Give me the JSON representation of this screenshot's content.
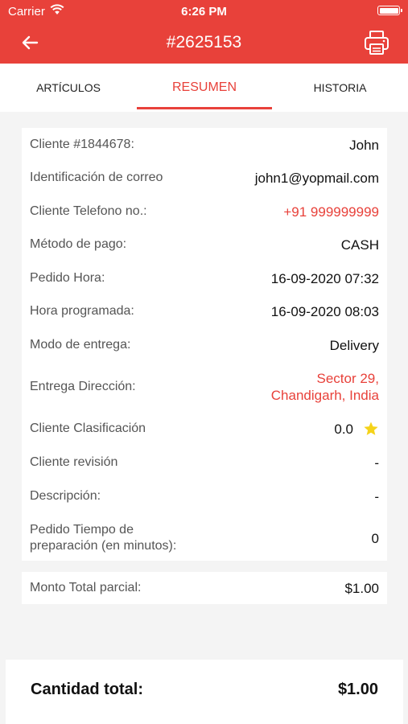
{
  "status_bar": {
    "carrier": "Carrier",
    "time": "6:26 PM"
  },
  "header": {
    "title": "#2625153",
    "back_icon": "arrow-left-icon",
    "print_icon": "printer-icon"
  },
  "tabs": [
    {
      "label": "ARTÍCULOS",
      "active": false
    },
    {
      "label": "RESUMEN",
      "active": true
    },
    {
      "label": "HISTORIA",
      "active": false
    }
  ],
  "details": {
    "customer": {
      "label": "Cliente #1844678:",
      "value": "John"
    },
    "email": {
      "label": "Identificación de correo",
      "value": "john1@yopmail.com"
    },
    "phone": {
      "label": "Cliente Telefono no.:",
      "value": "+91 999999999"
    },
    "payment": {
      "label": "Método de pago:",
      "value": "CASH"
    },
    "order_time": {
      "label": "Pedido Hora:",
      "value": "16-09-2020 07:32"
    },
    "scheduled_time": {
      "label": "Hora programada:",
      "value": "16-09-2020 08:03"
    },
    "delivery_mode": {
      "label": "Modo de entrega:",
      "value": "Delivery"
    },
    "address": {
      "label": "Entrega Dirección:",
      "line1": "Sector 29,",
      "line2": "Chandigarh, India"
    },
    "rating": {
      "label": "Cliente Clasificación",
      "value": "0.0"
    },
    "review": {
      "label": "Cliente revisión",
      "value": "-"
    },
    "description": {
      "label": "Descripción:",
      "value": "-"
    },
    "prep_time": {
      "label_line1": "Pedido Tiempo de",
      "label_line2": "preparación (en minutos):",
      "value": "0"
    }
  },
  "subtotal": {
    "label": "Monto Total parcial:",
    "value": "$1.00"
  },
  "total": {
    "label": "Cantidad total:",
    "value": "$1.00"
  },
  "colors": {
    "accent": "#e8413a",
    "star": "#f5d31a",
    "background": "#f4f4f4"
  }
}
